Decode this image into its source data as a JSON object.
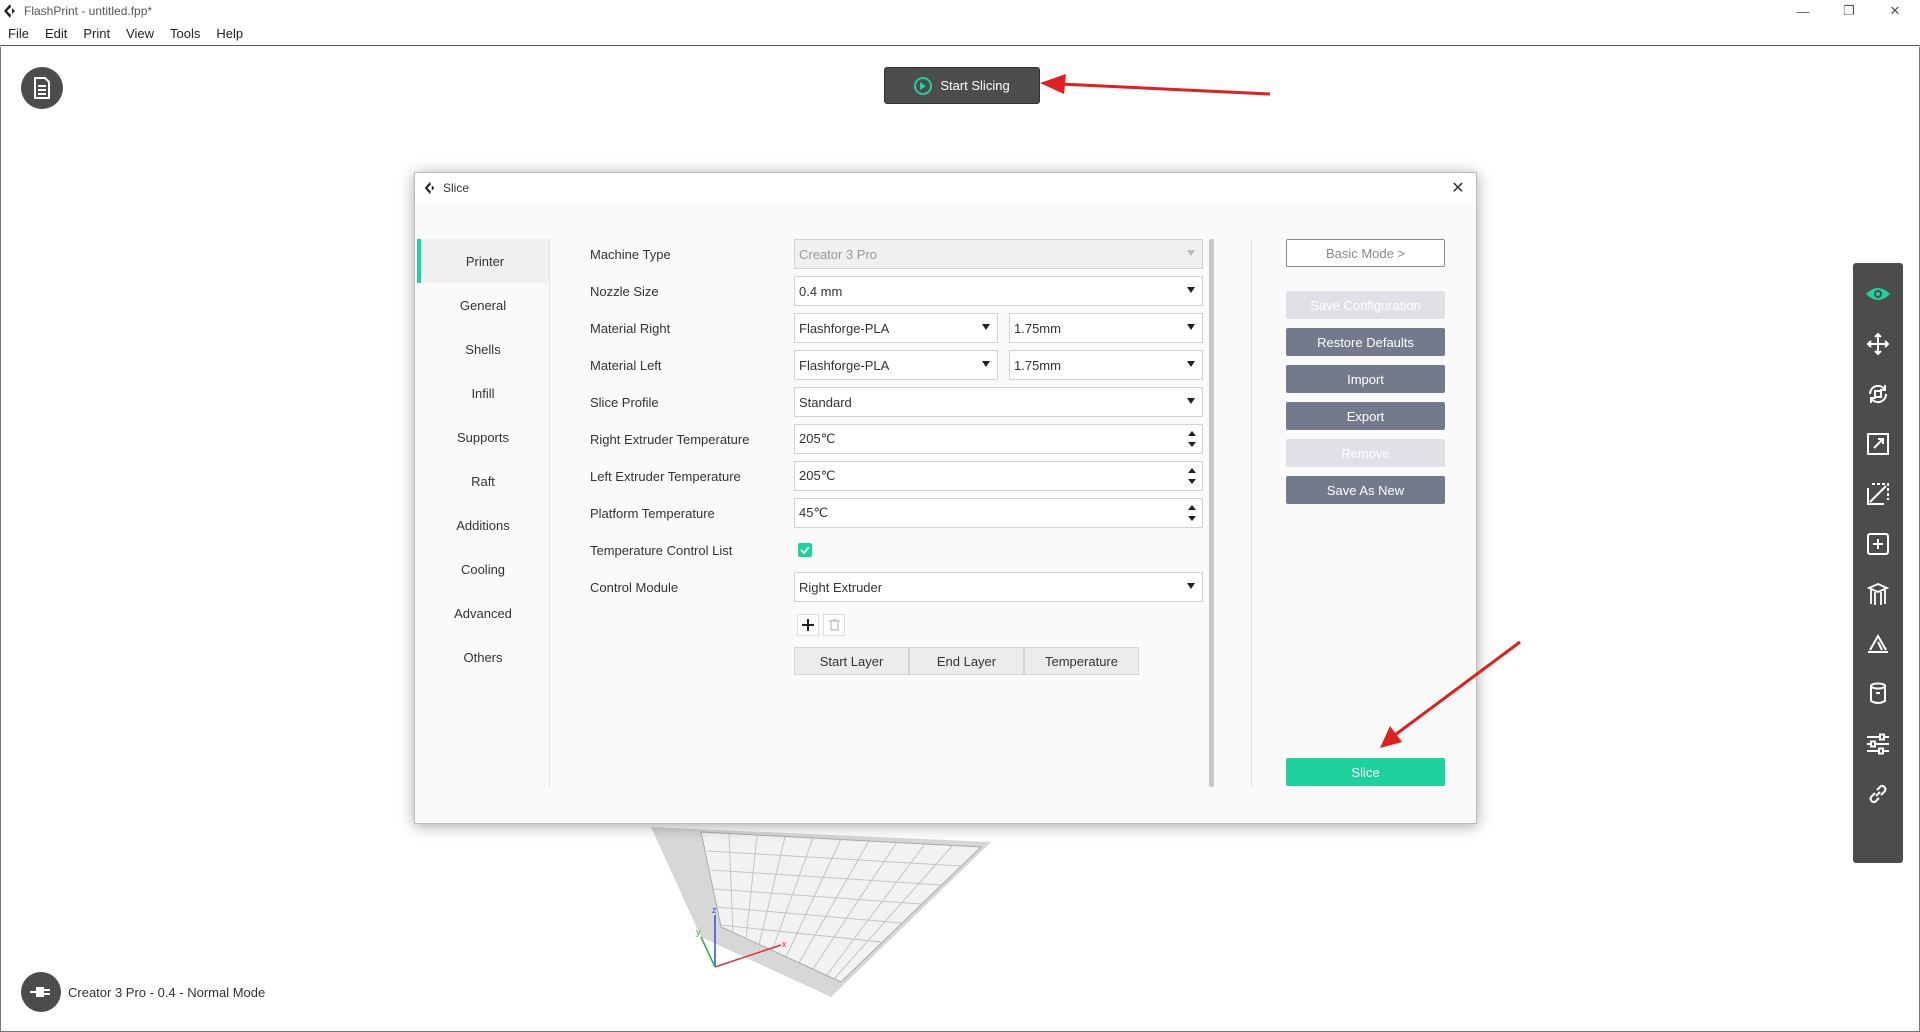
{
  "window": {
    "title": "FlashPrint - untitled.fpp*",
    "minimize": "—",
    "restore": "❐",
    "close": "✕"
  },
  "menu": [
    "File",
    "Edit",
    "Print",
    "View",
    "Tools",
    "Help"
  ],
  "toolbar": {
    "start_slicing": "Start Slicing"
  },
  "status": {
    "text": "Creator 3 Pro - 0.4 - Normal Mode"
  },
  "dialog": {
    "title": "Slice",
    "close": "✕",
    "tabs": [
      "Printer",
      "General",
      "Shells",
      "Infill",
      "Supports",
      "Raft",
      "Additions",
      "Cooling",
      "Advanced",
      "Others"
    ],
    "active_tab": "Printer",
    "fields": {
      "machine_type": {
        "label": "Machine Type",
        "value": "Creator 3 Pro"
      },
      "nozzle_size": {
        "label": "Nozzle Size",
        "value": "0.4 mm"
      },
      "material_right": {
        "label": "Material Right",
        "value": "Flashforge-PLA",
        "diameter": "1.75mm"
      },
      "material_left": {
        "label": "Material Left",
        "value": "Flashforge-PLA",
        "diameter": "1.75mm"
      },
      "slice_profile": {
        "label": "Slice Profile",
        "value": "Standard"
      },
      "right_extruder_temp": {
        "label": "Right Extruder Temperature",
        "value": "205℃"
      },
      "left_extruder_temp": {
        "label": "Left Extruder Temperature",
        "value": "205℃"
      },
      "platform_temp": {
        "label": "Platform Temperature",
        "value": "45℃"
      },
      "temp_control_list": {
        "label": "Temperature Control List",
        "checked": true
      },
      "control_module": {
        "label": "Control Module",
        "value": "Right Extruder"
      }
    },
    "temp_table": {
      "columns": [
        "Start Layer",
        "End Layer",
        "Temperature"
      ]
    },
    "buttons": {
      "basic_mode": "Basic Mode >",
      "save_configuration": "Save Configuration",
      "restore_defaults": "Restore Defaults",
      "import": "Import",
      "export": "Export",
      "remove": "Remove",
      "save_as_new": "Save As New",
      "slice": "Slice"
    }
  },
  "axes": {
    "x": "x",
    "y": "y",
    "z": "z"
  },
  "right_toolbar": [
    "eye-icon",
    "move-icon",
    "rotate-icon",
    "scale-icon",
    "cut-icon",
    "add-model-icon",
    "support-icon",
    "leveling-icon",
    "extruder-icon",
    "settings-icon",
    "link-icon"
  ],
  "colors": {
    "accent": "#1ed29e",
    "dark": "#4c4c4c",
    "button": "#727a8c",
    "annotation": "#e02020"
  }
}
